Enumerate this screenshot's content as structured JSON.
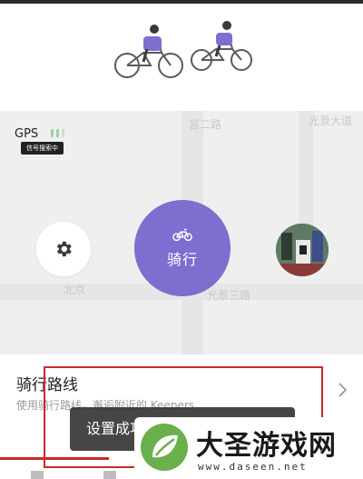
{
  "status": {
    "gps_label": "GPS",
    "gps_tooltip": "信号搜索中"
  },
  "map": {
    "labels": [
      "富二路",
      "光景大道",
      "光景三路",
      "北京"
    ]
  },
  "controls": {
    "start_label": "骑行",
    "accent_color": "#7c6fcf",
    "settings_icon": "gear-icon",
    "start_icon": "bicycle-icon"
  },
  "route": {
    "title": "骑行路线",
    "description": "使用骑行路线，邂逅附近的 Keepers"
  },
  "toast": {
    "text": "设置成功"
  },
  "watermark": {
    "title": "大圣游戏网",
    "url": "www.daseen.net"
  }
}
